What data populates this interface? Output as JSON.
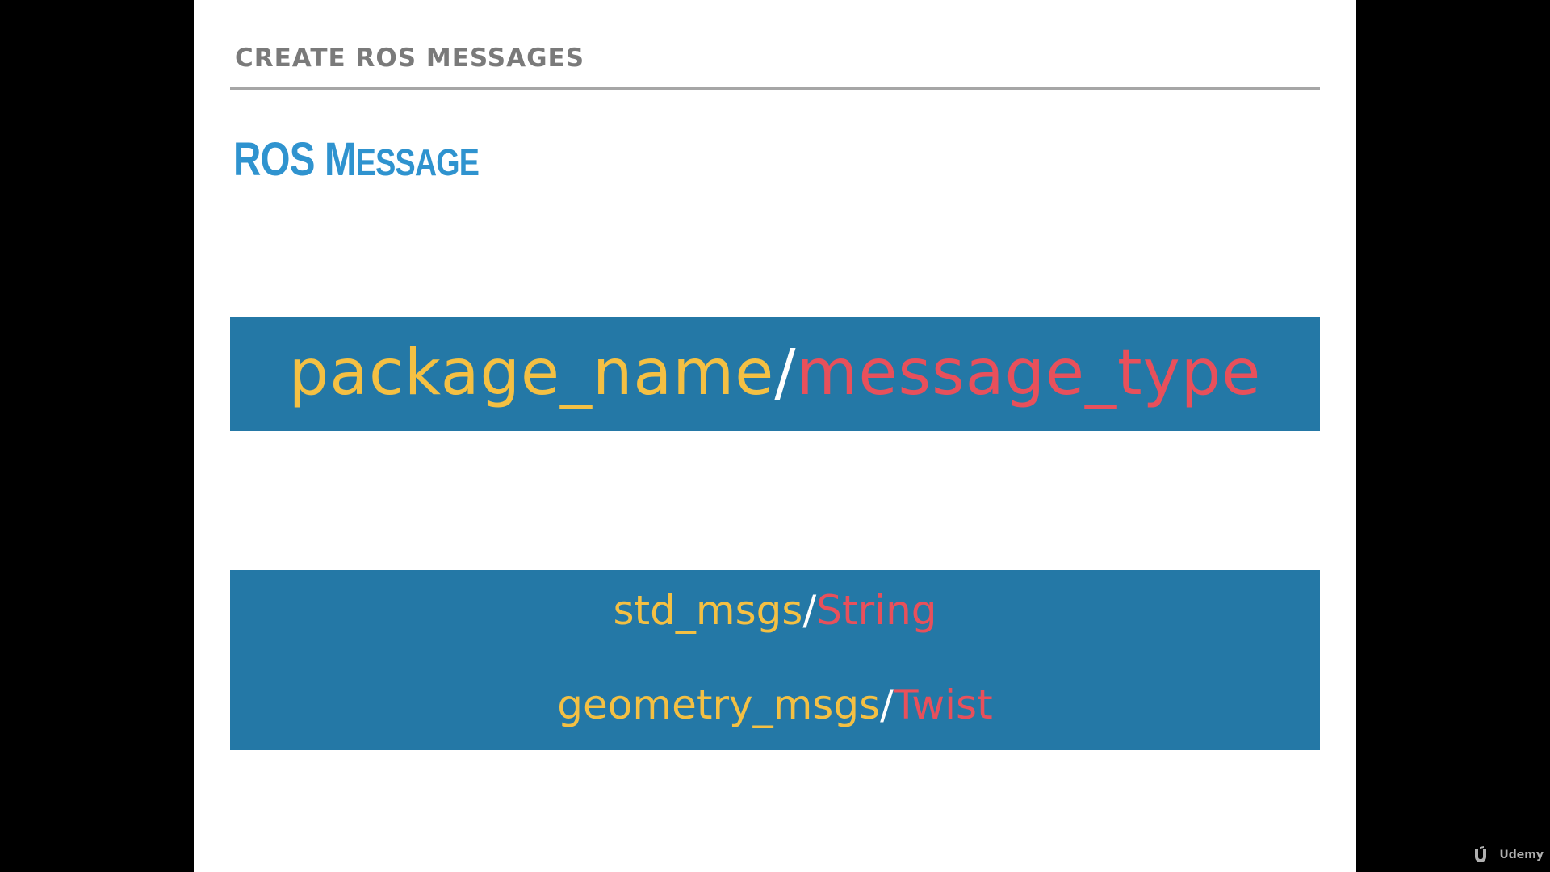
{
  "slide": {
    "section_title": "CREATE ROS MESSAGES",
    "heading": {
      "part1": "ROS M",
      "part2": "ESSAGE"
    },
    "format": {
      "package": "package_name",
      "slash": "/",
      "type": "message_type"
    },
    "examples": [
      {
        "package": "std_msgs",
        "slash": "/",
        "type": "String"
      },
      {
        "package": "geometry_msgs",
        "slash": "/",
        "type": "Twist"
      }
    ]
  },
  "watermark": {
    "text": "Udemy",
    "icon": "udemy-logo-icon"
  },
  "colors": {
    "heading": "#2f93cf",
    "box": "#2478a6",
    "package": "#f4c043",
    "type": "#e8505b",
    "slash": "#ffffff",
    "section_title": "#7a7a7a"
  }
}
